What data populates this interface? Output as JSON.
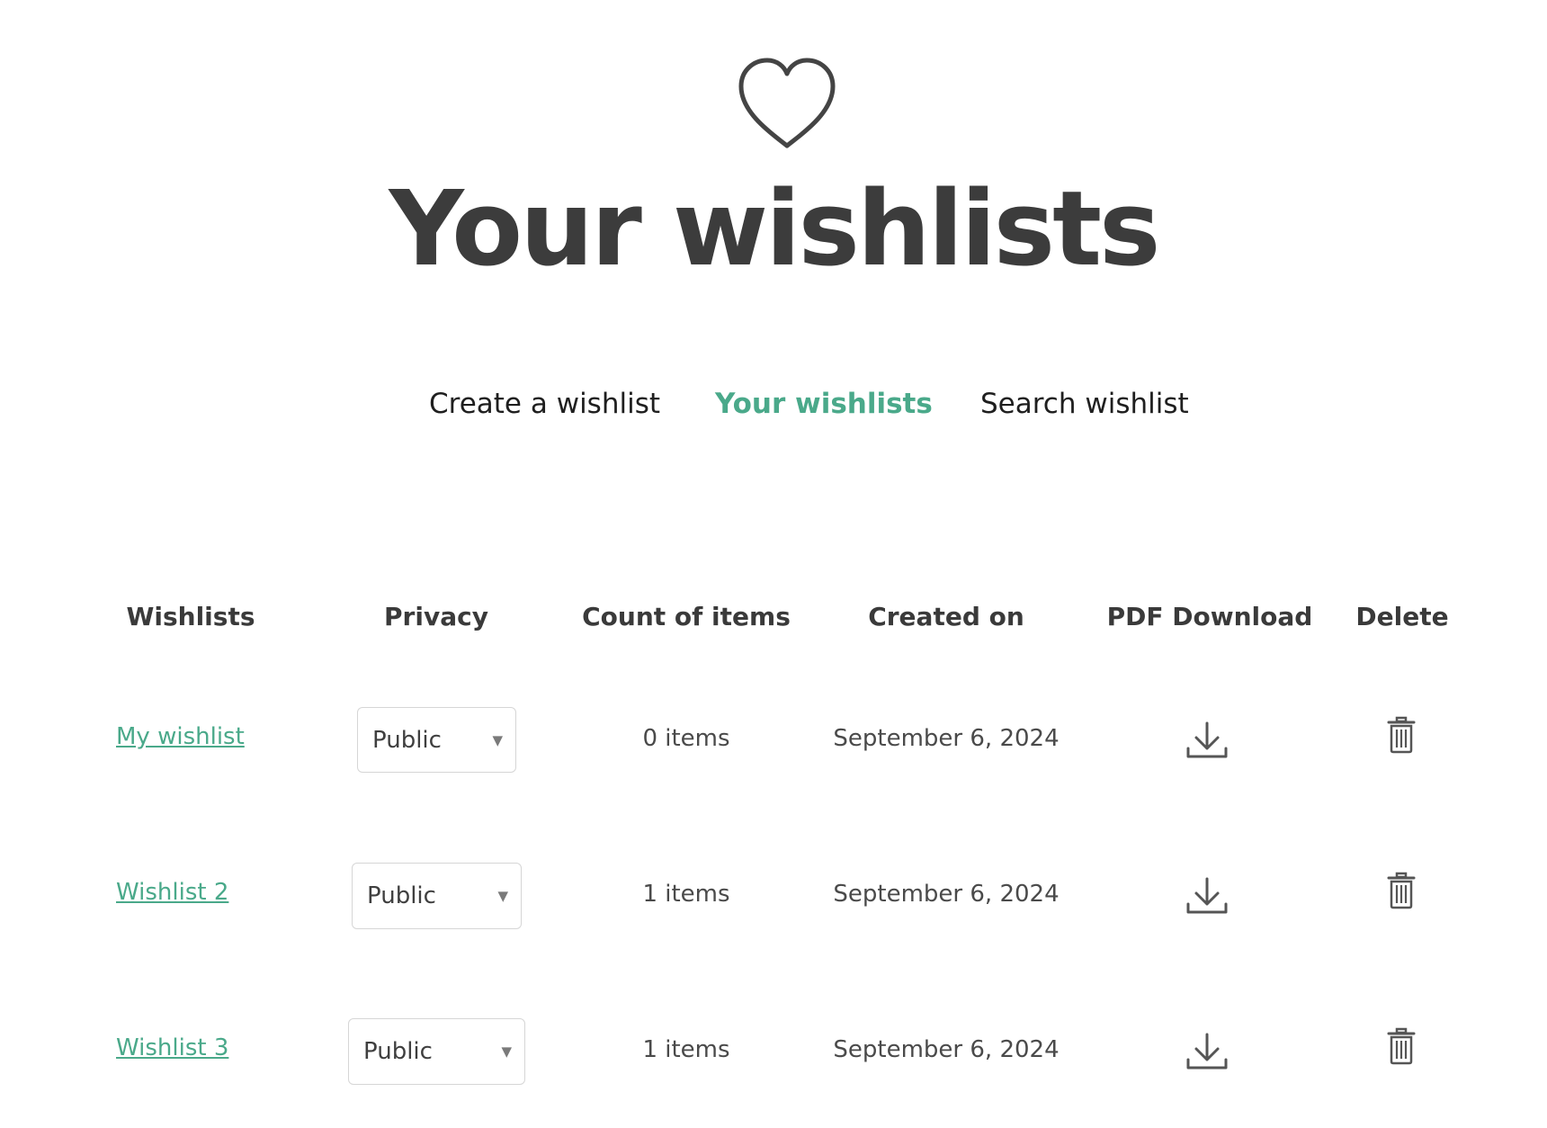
{
  "page": {
    "title": "Your wishlists",
    "header_icon": "heart-outline-icon"
  },
  "tabs": [
    {
      "label": "Create a wishlist",
      "active": false
    },
    {
      "label": "Your wishlists",
      "active": true
    },
    {
      "label": "Search wishlist",
      "active": false
    }
  ],
  "table": {
    "headers": [
      "Wishlists",
      "Privacy",
      "Count of items",
      "Created on",
      "PDF Download",
      "Delete"
    ],
    "rows": [
      {
        "name": "My wishlist ",
        "privacy": "Public",
        "count": "0 items",
        "created": "September 6, 2024",
        "download_icon": "download-icon",
        "delete_icon": "trash-icon"
      },
      {
        "name": "Wishlist 2 ",
        "privacy": "Public",
        "count": "1 items",
        "created": "September 6, 2024",
        "download_icon": "download-icon",
        "delete_icon": "trash-icon"
      },
      {
        "name": "Wishlist 3 ",
        "privacy": "Public",
        "count": "1 items",
        "created": "September 6, 2024",
        "download_icon": "download-icon",
        "delete_icon": "trash-icon"
      }
    ]
  },
  "colors": {
    "accent": "#4aa98a",
    "text": "#3c3c3c",
    "border": "#d6d6d6"
  }
}
